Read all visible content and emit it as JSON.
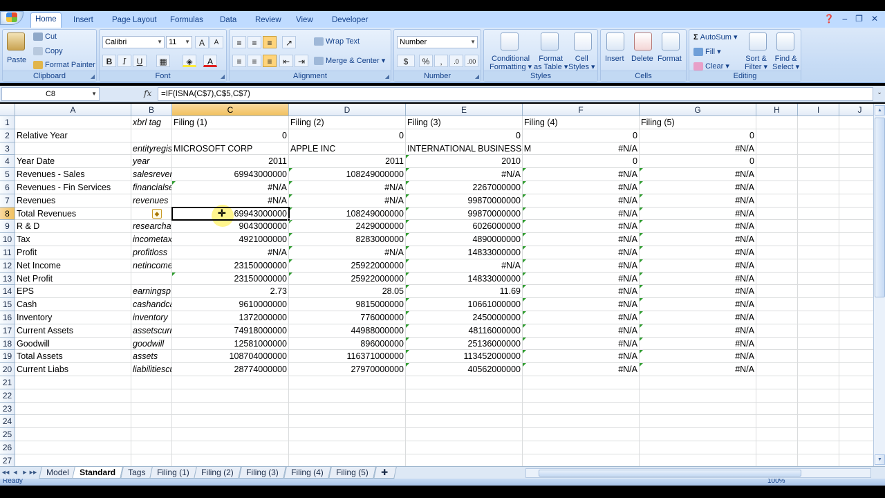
{
  "ribbon": {
    "tabs": [
      "Home",
      "Insert",
      "Page Layout",
      "Formulas",
      "Data",
      "Review",
      "View",
      "Developer"
    ],
    "clipboard": {
      "paste": "Paste",
      "cut": "Cut",
      "copy": "Copy",
      "format_painter": "Format Painter",
      "label": "Clipboard"
    },
    "font": {
      "name": "Calibri",
      "size": "11",
      "label": "Font"
    },
    "alignment": {
      "wrap_text": "Wrap Text",
      "merge_center": "Merge & Center",
      "label": "Alignment"
    },
    "number": {
      "format": "Number",
      "label": "Number"
    },
    "styles": {
      "conditional": "Conditional",
      "formatting": "Formatting",
      "format_as": "Format",
      "as_table": "as Table",
      "cell": "Cell",
      "cell_styles": "Styles",
      "label": "Styles"
    },
    "cells": {
      "insert": "Insert",
      "delete": "Delete",
      "format": "Format",
      "label": "Cells"
    },
    "editing": {
      "autosum": "AutoSum",
      "fill": "Fill",
      "clear": "Clear",
      "sort": "Sort &",
      "filter": "Filter",
      "find": "Find &",
      "select": "Select",
      "label": "Editing"
    }
  },
  "formula_bar": {
    "name_box": "C8",
    "formula": "=IF(ISNA(C$7),C$5,C$7)"
  },
  "columns": [
    "A",
    "B",
    "C",
    "D",
    "E",
    "F",
    "G",
    "H",
    "I",
    "J"
  ],
  "rows": [
    [
      "",
      "xbrl tag",
      "Filing (1)",
      "Filing (2)",
      "Filing (3)",
      "Filing (4)",
      "Filing (5)"
    ],
    [
      "Relative Year",
      "",
      "0",
      "0",
      "0",
      "0",
      "0"
    ],
    [
      "",
      "entityregis",
      "MICROSOFT CORP",
      "APPLE INC",
      "INTERNATIONAL BUSINESS M",
      "#N/A",
      "#N/A"
    ],
    [
      "Year Date",
      "year",
      "2011",
      "2011",
      "2010",
      "0",
      "0"
    ],
    [
      "Revenues - Sales",
      "salesrever",
      "69943000000",
      "108249000000",
      "#N/A",
      "#N/A",
      "#N/A"
    ],
    [
      "Revenues - Fin Services",
      "financialse",
      "#N/A",
      "#N/A",
      "2267000000",
      "#N/A",
      "#N/A"
    ],
    [
      "Revenues",
      "revenues",
      "#N/A",
      "#N/A",
      "99870000000",
      "#N/A",
      "#N/A"
    ],
    [
      "Total Revenues",
      "",
      "69943000000",
      "108249000000",
      "99870000000",
      "#N/A",
      "#N/A"
    ],
    [
      "R & D",
      "researcha",
      "9043000000",
      "2429000000",
      "6026000000",
      "#N/A",
      "#N/A"
    ],
    [
      "Tax",
      "incometax",
      "4921000000",
      "8283000000",
      "4890000000",
      "#N/A",
      "#N/A"
    ],
    [
      "Profit",
      "profitloss",
      "#N/A",
      "#N/A",
      "14833000000",
      "#N/A",
      "#N/A"
    ],
    [
      "Net Income",
      "netincome",
      "23150000000",
      "25922000000",
      "#N/A",
      "#N/A",
      "#N/A"
    ],
    [
      "Net Profit",
      "",
      "23150000000",
      "25922000000",
      "14833000000",
      "#N/A",
      "#N/A"
    ],
    [
      "EPS",
      "earningsp",
      "2.73",
      "28.05",
      "11.69",
      "#N/A",
      "#N/A"
    ],
    [
      "Cash",
      "cashandca",
      "9610000000",
      "9815000000",
      "10661000000",
      "#N/A",
      "#N/A"
    ],
    [
      "Inventory",
      "inventory",
      "1372000000",
      "776000000",
      "2450000000",
      "#N/A",
      "#N/A"
    ],
    [
      "Current Assets",
      "assetscurr",
      "74918000000",
      "44988000000",
      "48116000000",
      "#N/A",
      "#N/A"
    ],
    [
      "Goodwill",
      "goodwill",
      "12581000000",
      "896000000",
      "25136000000",
      "#N/A",
      "#N/A"
    ],
    [
      "Total Assets",
      "assets",
      "108704000000",
      "116371000000",
      "113452000000",
      "#N/A",
      "#N/A"
    ],
    [
      "Current Liabs",
      "liabilitiescu",
      "28774000000",
      "27970000000",
      "40562000000",
      "#N/A",
      "#N/A"
    ]
  ],
  "total_rows_shown": 27,
  "sheet_tabs": [
    "Model",
    "Standard",
    "Tags",
    "Filing (1)",
    "Filing (2)",
    "Filing (3)",
    "Filing (4)",
    "Filing (5)"
  ],
  "active_sheet": "Standard",
  "status": {
    "left": "Ready",
    "zoom": "100%"
  },
  "colors": {
    "ribbon_bg": "#c6dbf5",
    "selected_header": "#f1c15f",
    "error_triangle": "#2e9c2e"
  }
}
